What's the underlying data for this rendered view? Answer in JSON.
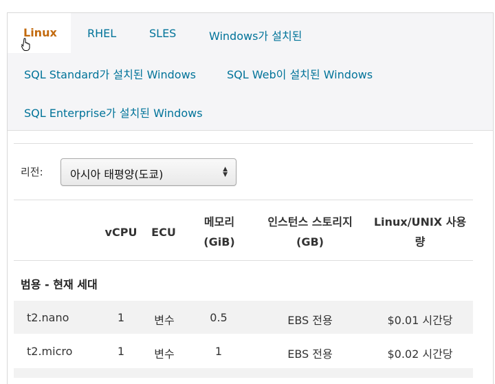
{
  "tabs": [
    {
      "label": "Linux",
      "active": true
    },
    {
      "label": "RHEL"
    },
    {
      "label": "SLES"
    },
    {
      "label": "Windows가 설치된"
    },
    {
      "label": "SQL Standard가 설치된 Windows"
    },
    {
      "label": "SQL Web이 설치된 Windows"
    },
    {
      "label": "SQL Enterprise가 설치된 Windows"
    }
  ],
  "region": {
    "label": "리전:",
    "selected": "아시아 태평양(도쿄)"
  },
  "table": {
    "headers": [
      "",
      "vCPU",
      "ECU",
      "메모리 (GiB)",
      "인스턴스 스토리지 (GB)",
      "Linux/UNIX 사용량"
    ],
    "header_lines": {
      "memory_1": "메모리",
      "memory_2": "(GiB)",
      "storage_1": "인스턴스 스토리지",
      "storage_2": "(GB)",
      "usage_1": "Linux/UNIX 사용",
      "usage_2": "량"
    },
    "section": "범용 - 현재 세대",
    "rows": [
      {
        "name": "t2.nano",
        "vcpu": "1",
        "ecu": "변수",
        "memory": "0.5",
        "storage": "EBS 전용",
        "price": "$0.01 시간당"
      },
      {
        "name": "t2.micro",
        "vcpu": "1",
        "ecu": "변수",
        "memory": "1",
        "storage": "EBS 전용",
        "price": "$0.02 시간당"
      }
    ]
  },
  "colors": {
    "active_tab": "#c26a0e",
    "tab_link": "#007399",
    "row_stripe": "#f2f2f2"
  },
  "icons": {
    "cursor": "hand-pointer-icon",
    "select": "select-updown-arrows-icon"
  }
}
